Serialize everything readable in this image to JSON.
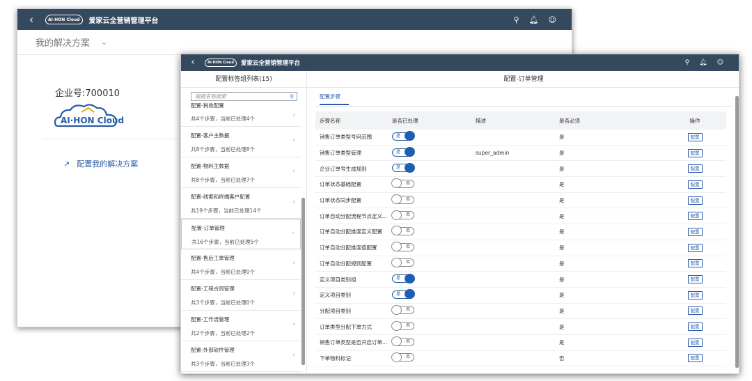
{
  "app": {
    "title": "爱家云全营销管理平台",
    "logo_text": "AI·HON Cloud"
  },
  "back_window": {
    "solution_label": "我的解决方案",
    "company_id": "企业号:700010",
    "brand_text": "AI·HON Cloud",
    "config_link": "配置我的解决方案"
  },
  "left_pane": {
    "header": "配置标签组列表(15)",
    "search_placeholder": "根据名称搜索",
    "groups": [
      {
        "name": "配置-税收配置",
        "summary": "共4个步骤，当前已处理4个"
      },
      {
        "name": "配置-客户主数据",
        "summary": "共8个步骤，当前已处理8个"
      },
      {
        "name": "配置-物料主数据",
        "summary": "共8个步骤，当前已处理7个"
      },
      {
        "name": "配置-线索和终端客户配置",
        "summary": "共19个步骤，当前已处理14个"
      },
      {
        "name": "配置-订单管理",
        "summary": "共16个步骤，当前已处理5个"
      },
      {
        "name": "配置-售后工单管理",
        "summary": "共4个步骤，当前已处理0个"
      },
      {
        "name": "配置-工程合同管理",
        "summary": "共3个步骤，当前已处理0个"
      },
      {
        "name": "配置-工作流管理",
        "summary": "共2个步骤，当前已处理2个"
      },
      {
        "name": "配置-外部软件管理",
        "summary": "共3个步骤，当前已处理3个"
      }
    ],
    "active_index": 4
  },
  "right_pane": {
    "header": "配置-订单管理",
    "tab": "配置步骤",
    "columns": [
      "步骤名称",
      "是否已处理",
      "描述",
      "是否必须",
      "操作"
    ],
    "toggle_on_label": "是",
    "toggle_off_label": "否",
    "op_label": "配置",
    "rows": [
      {
        "name": "销售订单类型号码范围",
        "processed": true,
        "desc": "",
        "required": "是"
      },
      {
        "name": "销售订单类型管理",
        "processed": true,
        "desc": "super_admin",
        "required": "是"
      },
      {
        "name": "企业订单号生成规则",
        "processed": true,
        "desc": "",
        "required": "是"
      },
      {
        "name": "订单状态基础配置",
        "processed": false,
        "desc": "",
        "required": "是"
      },
      {
        "name": "订单状态同步配置",
        "processed": false,
        "desc": "",
        "required": "是"
      },
      {
        "name": "订单自动分配流程节点定义...",
        "processed": false,
        "desc": "",
        "required": "是"
      },
      {
        "name": "订单自动分配维度定义配置",
        "processed": false,
        "desc": "",
        "required": "是"
      },
      {
        "name": "订单自动分配维度值配置",
        "processed": false,
        "desc": "",
        "required": "是"
      },
      {
        "name": "订单自动分配规则配置",
        "processed": false,
        "desc": "",
        "required": "是"
      },
      {
        "name": "定义项目类别组",
        "processed": true,
        "desc": "",
        "required": "是"
      },
      {
        "name": "定义项目类别",
        "processed": true,
        "desc": "",
        "required": "是"
      },
      {
        "name": "分配项目类别",
        "processed": false,
        "desc": "",
        "required": "是"
      },
      {
        "name": "订单类型分配下单方式",
        "processed": false,
        "desc": "",
        "required": "是"
      },
      {
        "name": "销售订单类型是否开启订单...",
        "processed": false,
        "desc": "",
        "required": "是"
      },
      {
        "name": "下单物料标记",
        "processed": false,
        "desc": "",
        "required": "否"
      }
    ]
  }
}
